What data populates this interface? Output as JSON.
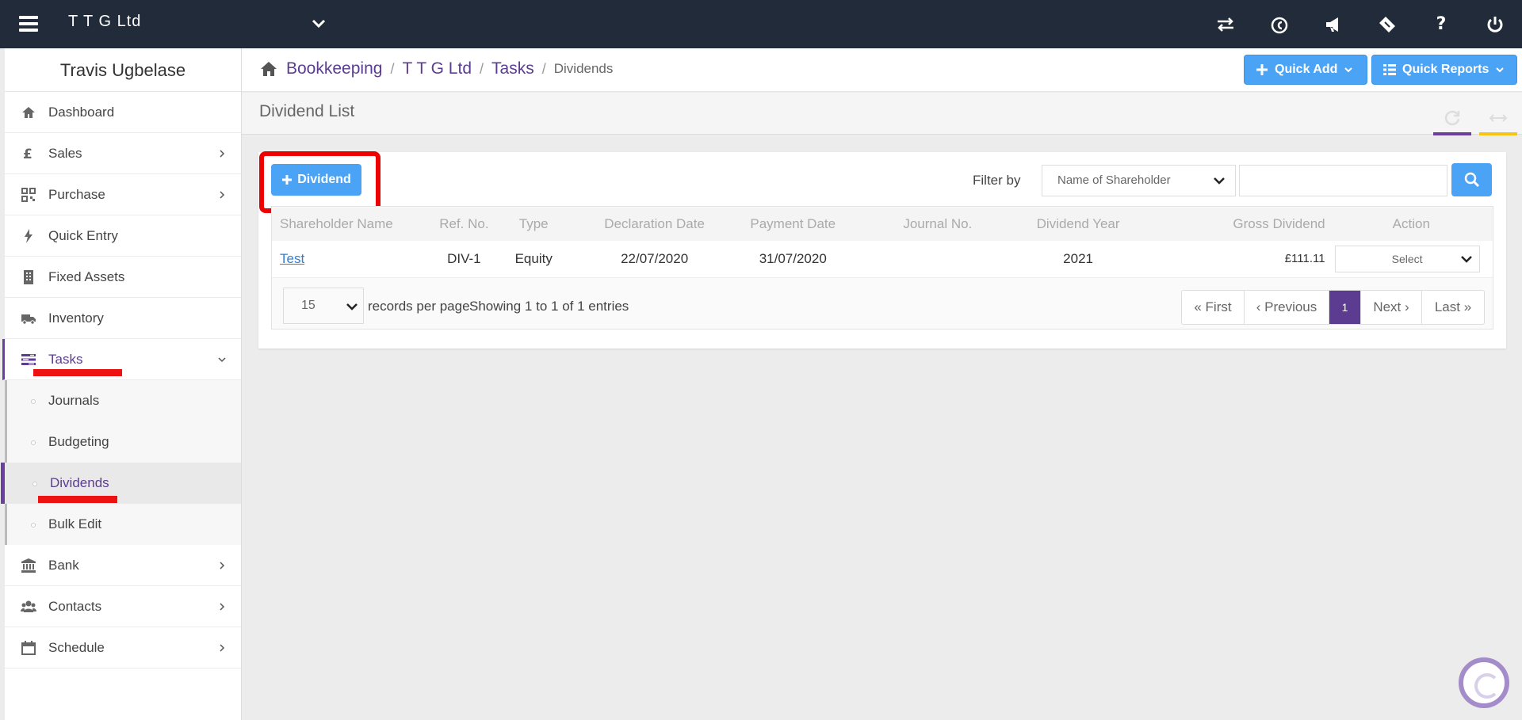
{
  "topbar": {
    "company": "T T G Ltd",
    "icons": [
      "switch-icon",
      "currency-icon",
      "megaphone-icon",
      "ticket-icon",
      "help-icon",
      "power-icon"
    ],
    "help_symbol": "?"
  },
  "sidebar": {
    "user": "Travis Ugbelase",
    "items": [
      {
        "label": "Dashboard",
        "icon": "home-icon"
      },
      {
        "label": "Sales",
        "icon": "pound-icon"
      },
      {
        "label": "Purchase",
        "icon": "qrcode-icon"
      },
      {
        "label": "Quick Entry",
        "icon": "bolt-icon"
      },
      {
        "label": "Fixed Assets",
        "icon": "building-icon"
      },
      {
        "label": "Inventory",
        "icon": "truck-icon"
      },
      {
        "label": "Tasks",
        "icon": "tasks-icon"
      }
    ],
    "sub_items": [
      "Journals",
      "Budgeting",
      "Dividends",
      "Bulk Edit"
    ],
    "items_after": [
      {
        "label": "Bank",
        "icon": "bank-icon"
      },
      {
        "label": "Contacts",
        "icon": "users-icon"
      },
      {
        "label": "Schedule",
        "icon": "calendar-icon"
      }
    ]
  },
  "breadcrumb": {
    "items": [
      "Bookkeeping",
      "T T G Ltd",
      "Tasks"
    ],
    "current": "Dividends",
    "separator": "/"
  },
  "header_buttons": {
    "quick_add": "Quick Add",
    "quick_reports": "Quick Reports"
  },
  "page": {
    "title": "Dividend List"
  },
  "toolbar": {
    "add_label": "Dividend",
    "filter_label": "Filter by",
    "filter_value": "Name of Shareholder",
    "search_value": ""
  },
  "table": {
    "columns": [
      "Shareholder Name",
      "Ref. No.",
      "Type",
      "Declaration Date",
      "Payment Date",
      "Journal No.",
      "Dividend Year",
      "Gross Dividend",
      "Action"
    ],
    "rows": [
      {
        "shareholder": "Test",
        "ref": "DIV-1",
        "type": "Equity",
        "declaration": "22/07/2020",
        "payment": "31/07/2020",
        "journal": "",
        "year": "2021",
        "gross": "£111.11",
        "action": "Select"
      }
    ]
  },
  "footer": {
    "per_page": "15",
    "per_page_label": "records per page",
    "info": "Showing 1 to 1 of 1 entries",
    "pager": {
      "first": "« First",
      "previous": "‹ Previous",
      "page": "1",
      "next": "Next ›",
      "last": "Last »"
    }
  },
  "colors": {
    "topbar": "#222b3a",
    "accent_purple": "#5c3c91",
    "primary_blue": "#4ba3f5",
    "highlight_red": "#e00000",
    "tool_bar_purple": "#6a3fa0",
    "tool_bar_yellow": "#f5c518"
  }
}
